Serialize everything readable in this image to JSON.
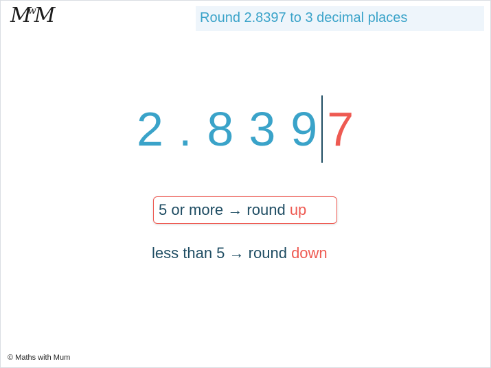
{
  "logo": {
    "text_left": "M",
    "text_middle": "w",
    "text_right": "M"
  },
  "header": {
    "title": "Round 2.8397 to 3 decimal places"
  },
  "number": {
    "digits": [
      "2",
      ".",
      "8",
      "3",
      "9"
    ],
    "cut_digit": "7"
  },
  "rules": {
    "rule1": {
      "lead": "5 or more",
      "arrow": "→",
      "action": "round",
      "direction": "up"
    },
    "rule2": {
      "lead": "less than 5",
      "arrow": "→",
      "action": "round",
      "direction": "down"
    }
  },
  "footer": {
    "copyright": "© Maths with Mum"
  },
  "colors": {
    "accent_blue": "#3aa3c9",
    "accent_red": "#ee5a52",
    "text_dark": "#1f4d63"
  }
}
